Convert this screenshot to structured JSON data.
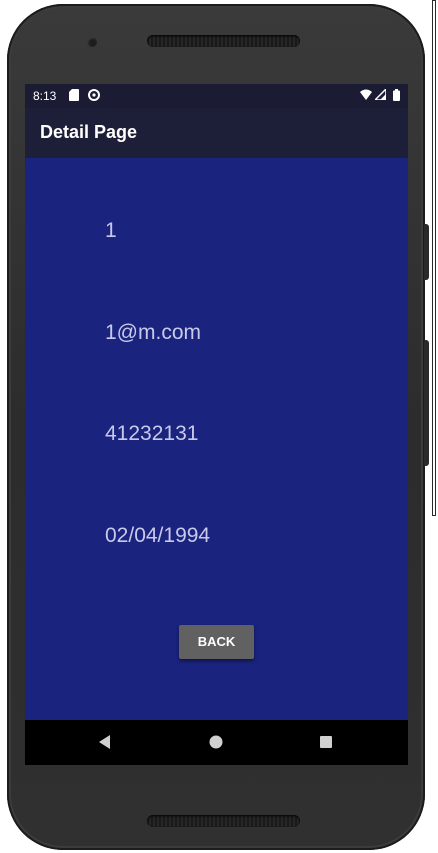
{
  "status_bar": {
    "time": "8:13",
    "icons": [
      "sd-card-icon",
      "sync-icon",
      "wifi-icon",
      "signal-icon",
      "battery-icon"
    ]
  },
  "app_bar": {
    "title": "Detail Page"
  },
  "detail": {
    "id": "1",
    "email": "1@m.com",
    "phone": "41232131",
    "birth_date": "02/04/1994"
  },
  "actions": {
    "back_label": "BACK"
  },
  "nav_bar": {
    "icons": [
      "back-triangle-icon",
      "home-circle-icon",
      "recents-square-icon"
    ]
  },
  "colors": {
    "content_background": "#1a237e",
    "app_bar": "#1d1e38",
    "button": "#616161",
    "text": "#c9c9ea"
  }
}
